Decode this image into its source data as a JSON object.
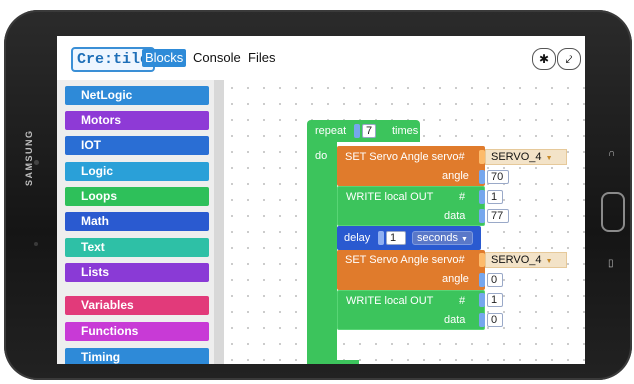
{
  "device": {
    "brand": "SAMSUNG"
  },
  "header": {
    "logo": "Cre:tile",
    "tabs": [
      {
        "label": "Blocks",
        "active": true
      },
      {
        "label": "Console",
        "active": false
      },
      {
        "label": "Files",
        "active": false
      }
    ],
    "icons": [
      "bluetooth-icon",
      "connect-plug-icon"
    ]
  },
  "sidebar": {
    "categories": [
      {
        "label": "NetLogic",
        "color": "#2e8ad8"
      },
      {
        "label": "Motors",
        "color": "#8e3ad6"
      },
      {
        "label": "IOT",
        "color": "#2a6ed4"
      },
      {
        "label": "Logic",
        "color": "#2aa0d8"
      },
      {
        "label": "Loops",
        "color": "#2ec05a"
      },
      {
        "label": "Math",
        "color": "#2a5ad0"
      },
      {
        "label": "Text",
        "color": "#2ec0a6"
      },
      {
        "label": "Lists",
        "color": "#8a3ad6"
      },
      {
        "label": "Variables",
        "color": "#e23a7a"
      },
      {
        "label": "Functions",
        "color": "#c83ad6"
      },
      {
        "label": "Timing",
        "color": "#2e8ad8"
      }
    ]
  },
  "workspace": {
    "repeat": {
      "label": "repeat",
      "count": "7",
      "suffix": "times",
      "do": "do",
      "color": "#3cc45c"
    },
    "servo1": {
      "label": "SET Servo Angle servo#",
      "servo": "SERVO_4",
      "angle_label": "angle",
      "angle": "70",
      "color": "#e07b2c"
    },
    "write1": {
      "label": "WRITE local OUT",
      "pin_label": "#",
      "pin": "1",
      "data_label": "data",
      "data": "77",
      "color": "#3cc45c"
    },
    "delay": {
      "label": "delay",
      "value": "1",
      "unit": "seconds",
      "color": "#2a5ad0"
    },
    "servo2": {
      "label": "SET Servo Angle servo#",
      "servo": "SERVO_4",
      "angle_label": "angle",
      "angle": "0",
      "color": "#e07b2c"
    },
    "write2": {
      "label": "WRITE local OUT",
      "pin_label": "#",
      "pin": "1",
      "data_label": "data",
      "data": "0",
      "color": "#3cc45c"
    }
  }
}
